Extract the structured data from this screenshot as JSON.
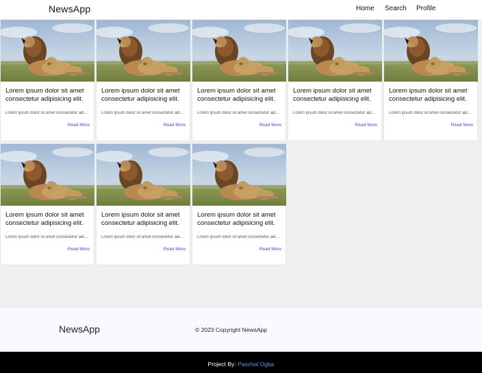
{
  "header": {
    "brand": "NewsApp",
    "nav": [
      "Home",
      "Search",
      "Profile"
    ]
  },
  "cards": [
    {
      "title": "Lorem ipsum dolor sit amet consectetur adipisicing elit.",
      "description": "Lorem ipsum dolor sit amet consectetur adipisicing elit.",
      "link": "Read More"
    },
    {
      "title": "Lorem ipsum dolor sit amet consectetur adipisicing elit.",
      "description": "Lorem ipsum dolor sit amet consectetur adipisicing elit.",
      "link": "Read More"
    },
    {
      "title": "Lorem ipsum dolor sit amet consectetur adipisicing elit.",
      "description": "Lorem ipsum dolor sit amet consectetur adipisicing elit.",
      "link": "Read More"
    },
    {
      "title": "Lorem ipsum dolor sit amet consectetur adipisicing elit.",
      "description": "Lorem ipsum dolor sit amet consectetur adipisicing elit.",
      "link": "Read More"
    },
    {
      "title": "Lorem ipsum dolor sit amet consectetur adipisicing elit.",
      "description": "Lorem ipsum dolor sit amet consectetur adipisicing elit.",
      "link": "Read More"
    },
    {
      "title": "Lorem ipsum dolor sit amet consectetur adipisicing elit.",
      "description": "Lorem ipsum dolor sit amet consectetur adipisicing elit.",
      "link": "Read More"
    },
    {
      "title": "Lorem ipsum dolor sit amet consectetur adipisicing elit.",
      "description": "Lorem ipsum dolor sit amet consectetur adipisicing elit.",
      "link": "Read More"
    },
    {
      "title": "Lorem ipsum dolor sit amet consectetur adipisicing elit.",
      "description": "Lorem ipsum dolor sit amet consectetur adipisicing elit.",
      "link": "Read More"
    }
  ],
  "footer": {
    "brand": "NewsApp",
    "copyright": "© 2023 Copyright NewsApp"
  },
  "bottom_bar": {
    "credit_label": "Project By:",
    "credit_name": "Paschal Ogba"
  },
  "colors": {
    "link": "#3b49df",
    "credit_name": "#6b8fe8",
    "page_background": "#efefef",
    "bottom_bar": "#000000"
  }
}
